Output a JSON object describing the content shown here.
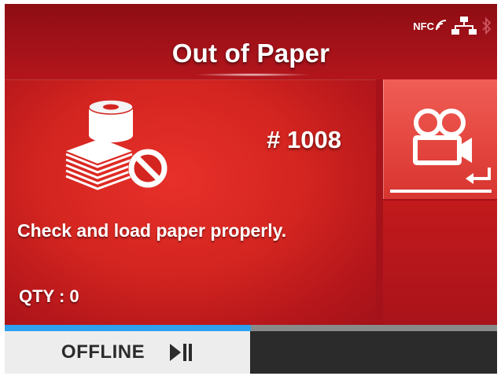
{
  "header": {
    "title": "Out of Paper",
    "status_icons": {
      "nfc_label": "NFC",
      "nfc_icon": "nfc-icon",
      "network_icon": "network-icon",
      "bluetooth_icon": "bluetooth-icon"
    }
  },
  "error": {
    "code": "# 1008",
    "icon": "paper-out-icon",
    "message": "Check and load paper properly.",
    "qty_label": "QTY : 0"
  },
  "side_button": {
    "icon": "video-enter-icon"
  },
  "footer": {
    "offline_label": "OFFLINE",
    "play_pause_icon": "play-pause-icon",
    "progress": 0.5
  },
  "colors": {
    "background_red": "#a5121a",
    "panel_red": "#d42520",
    "side_button_red": "#e4463f",
    "progress_blue": "#2ea0ee",
    "footer_light": "#ededed",
    "footer_dark": "#2b2b2b"
  }
}
